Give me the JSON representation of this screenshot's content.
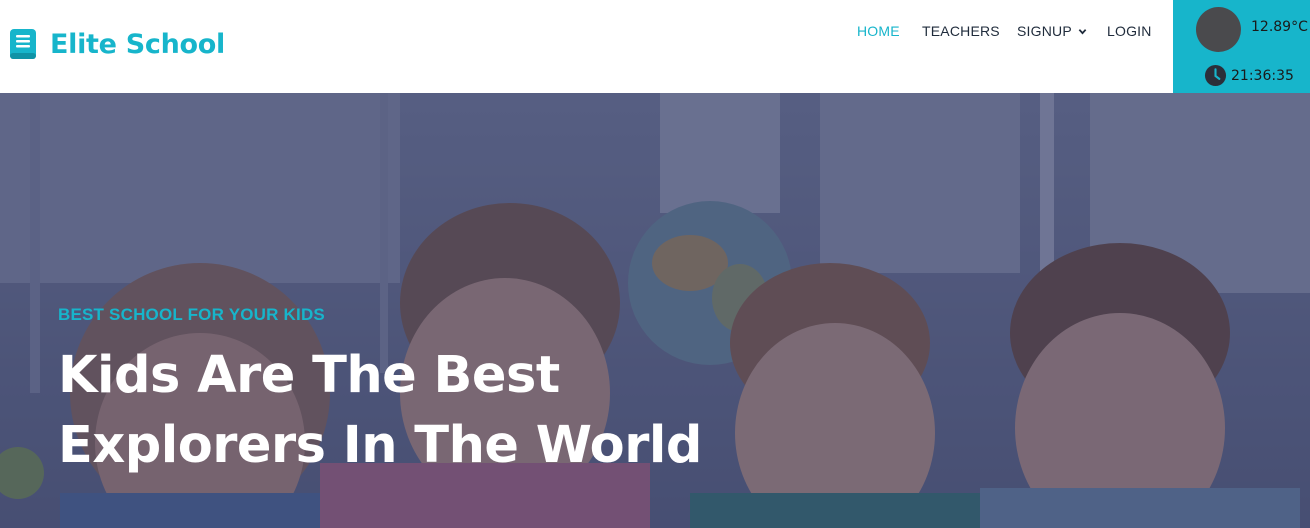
{
  "brand": {
    "name": "Elite School",
    "icon": "book-icon",
    "color": "#17b5cb"
  },
  "nav": {
    "items": [
      {
        "label": "HOME",
        "active": true
      },
      {
        "label": "TEACHERS",
        "active": false
      },
      {
        "label": "SIGNUP",
        "active": false,
        "dropdown": true
      },
      {
        "label": "LOGIN",
        "active": false
      }
    ]
  },
  "widget": {
    "temperature": "12.89°C",
    "time": "21:36:35",
    "weather_icon": "weather-icon",
    "clock_icon": "clock-icon",
    "background": "#17b5cb"
  },
  "hero": {
    "subtitle": "BEST SCHOOL FOR YOUR KIDS",
    "title_line1": "Kids Are The Best",
    "title_line2": "Explorers In The World",
    "image": "children-reading-photo"
  },
  "colors": {
    "accent": "#17b5cb",
    "nav_text": "#1f2b3b",
    "overlay": "#282e58"
  }
}
